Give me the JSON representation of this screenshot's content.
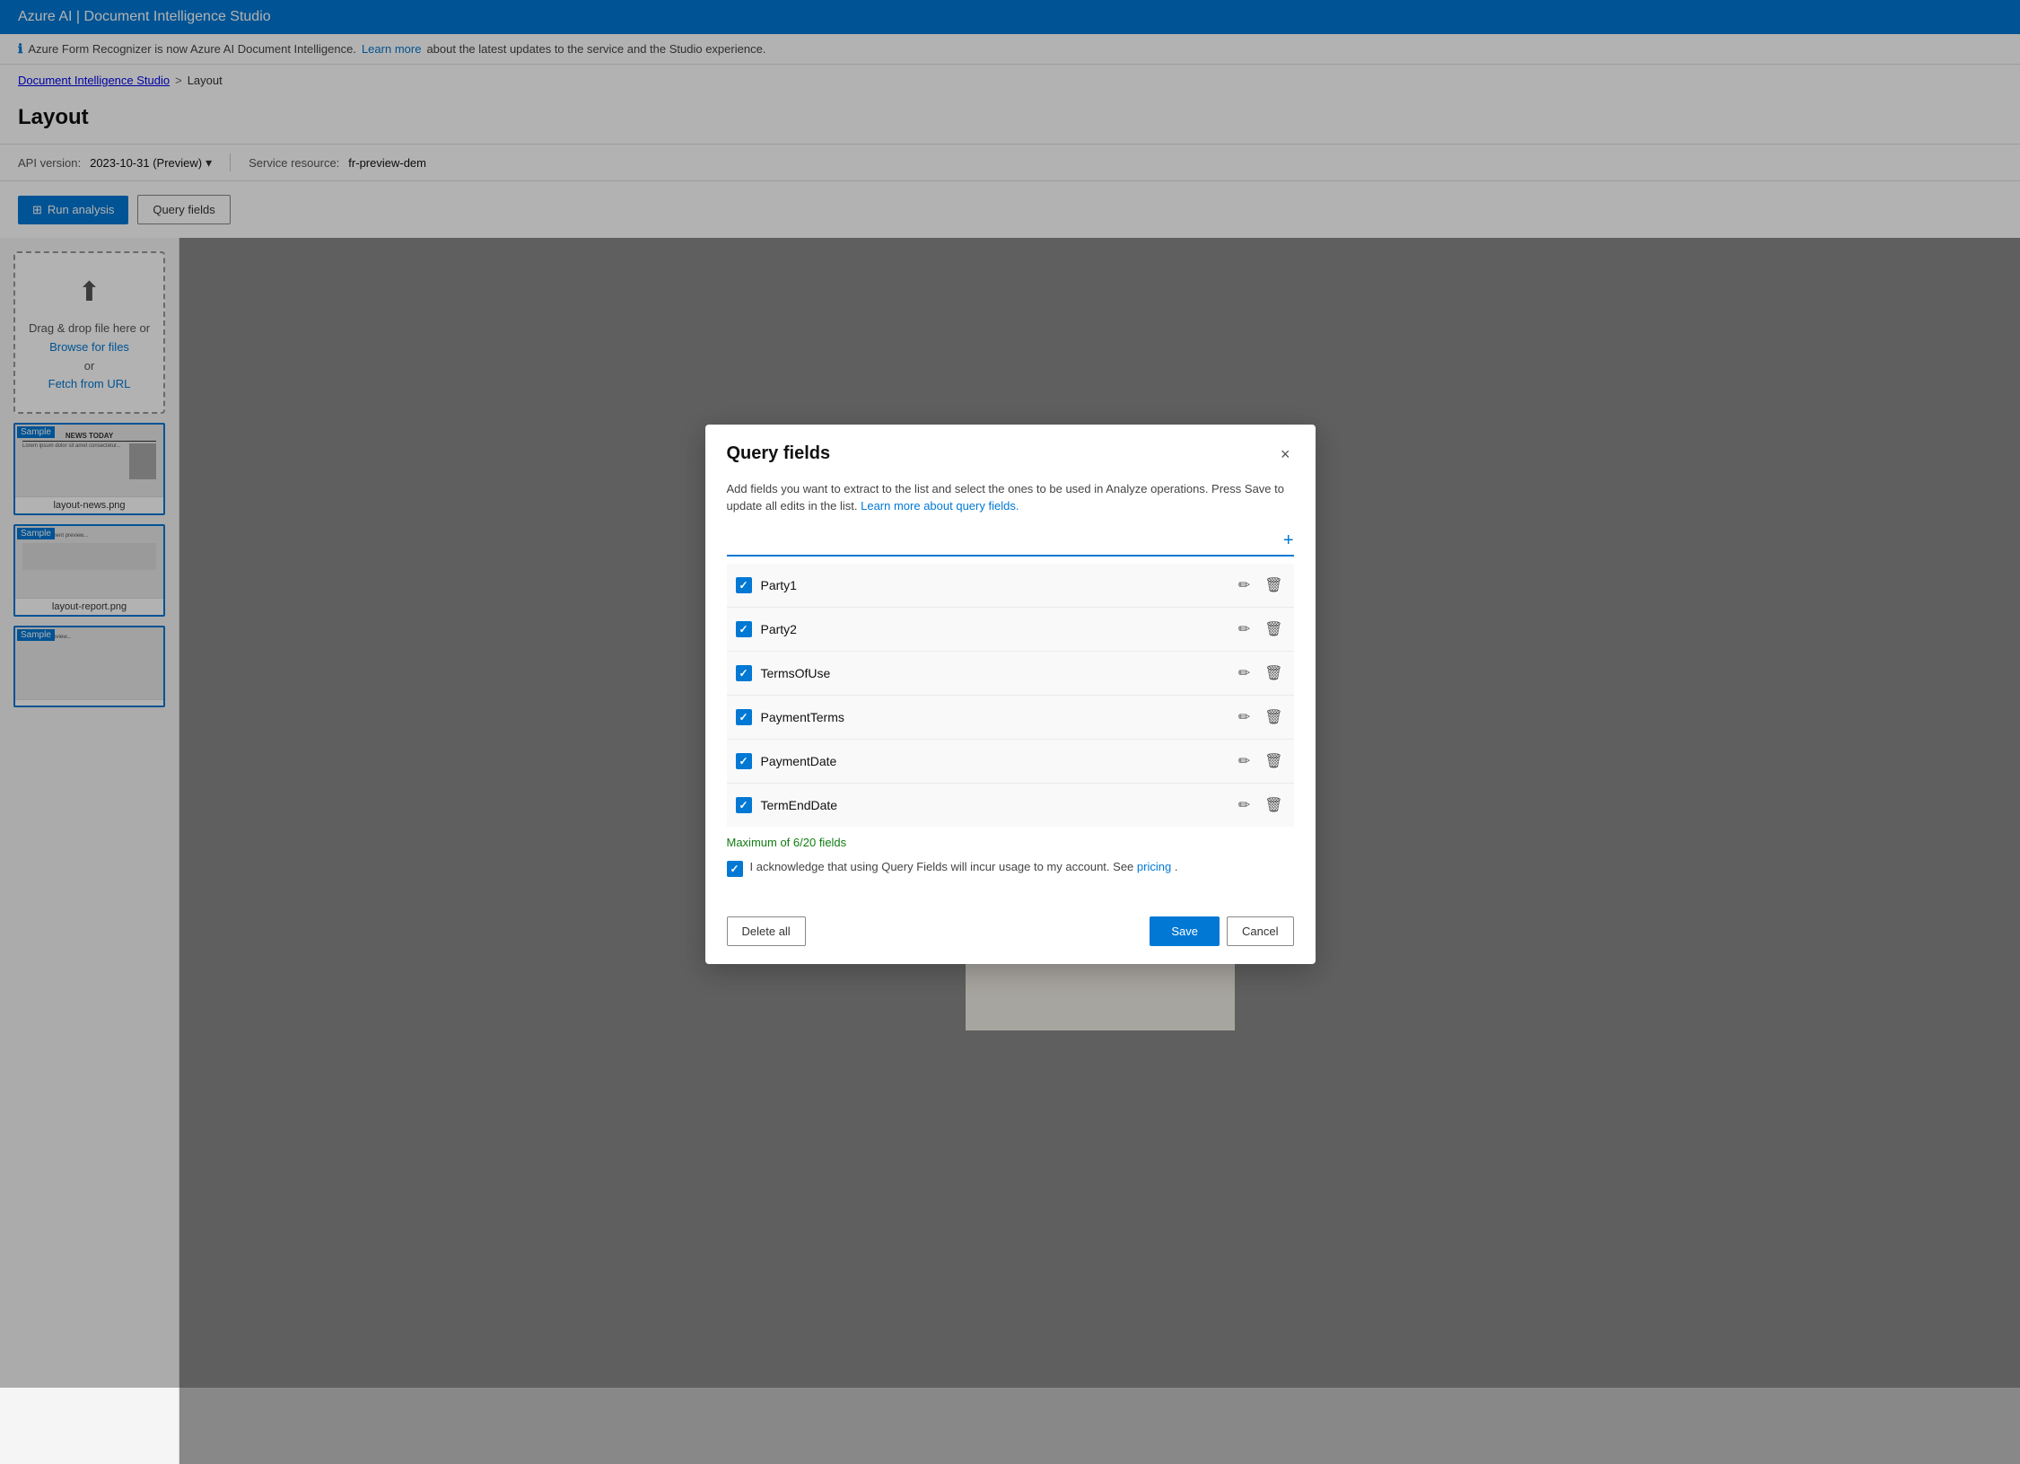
{
  "app": {
    "title": "Azure AI | Document Intelligence Studio"
  },
  "info_banner": {
    "text": "Azure Form Recognizer is now Azure AI Document Intelligence.",
    "link_text": "Learn more",
    "suffix": "about the latest updates to the service and the Studio experience."
  },
  "breadcrumb": {
    "parent": "Document Intelligence Studio",
    "separator": ">",
    "current": "Layout"
  },
  "page_title": "Layout",
  "toolbar": {
    "api_label": "API version:",
    "api_value": "2023-10-31 (Preview)",
    "service_label": "Service resource:",
    "service_value": "fr-preview-dem"
  },
  "action_bar": {
    "run_analysis_label": "Run analysis",
    "query_fields_label": "Query fields"
  },
  "drop_zone": {
    "main_text": "Drag & drop file here or",
    "browse_label": "Browse for files",
    "or_text": "or",
    "fetch_label": "Fetch from URL"
  },
  "file_thumbs": [
    {
      "name": "layout-news.png",
      "sample": "Sample"
    },
    {
      "name": "layout-report.png",
      "sample": "Sample"
    },
    {
      "name": "",
      "sample": "Sample"
    }
  ],
  "modal": {
    "title": "Query fields",
    "close_label": "×",
    "description": "Add fields you want to extract to the list and select the ones to be used in Analyze operations. Press Save to update all edits in the list.",
    "learn_more_text": "Learn more about query fields.",
    "add_placeholder": "",
    "add_btn_label": "+",
    "fields": [
      {
        "name": "Party1",
        "checked": true
      },
      {
        "name": "Party2",
        "checked": true
      },
      {
        "name": "TermsOfUse",
        "checked": true
      },
      {
        "name": "PaymentTerms",
        "checked": true
      },
      {
        "name": "PaymentDate",
        "checked": true
      },
      {
        "name": "TermEndDate",
        "checked": true
      }
    ],
    "status_text": "Maximum of 6/20 fields",
    "ack_text": "I acknowledge that using Query Fields will incur usage to my account. See",
    "ack_link_text": "pricing",
    "ack_suffix": ".",
    "ack_checked": true,
    "delete_all_label": "Delete all",
    "save_label": "Save",
    "cancel_label": "Cancel"
  }
}
